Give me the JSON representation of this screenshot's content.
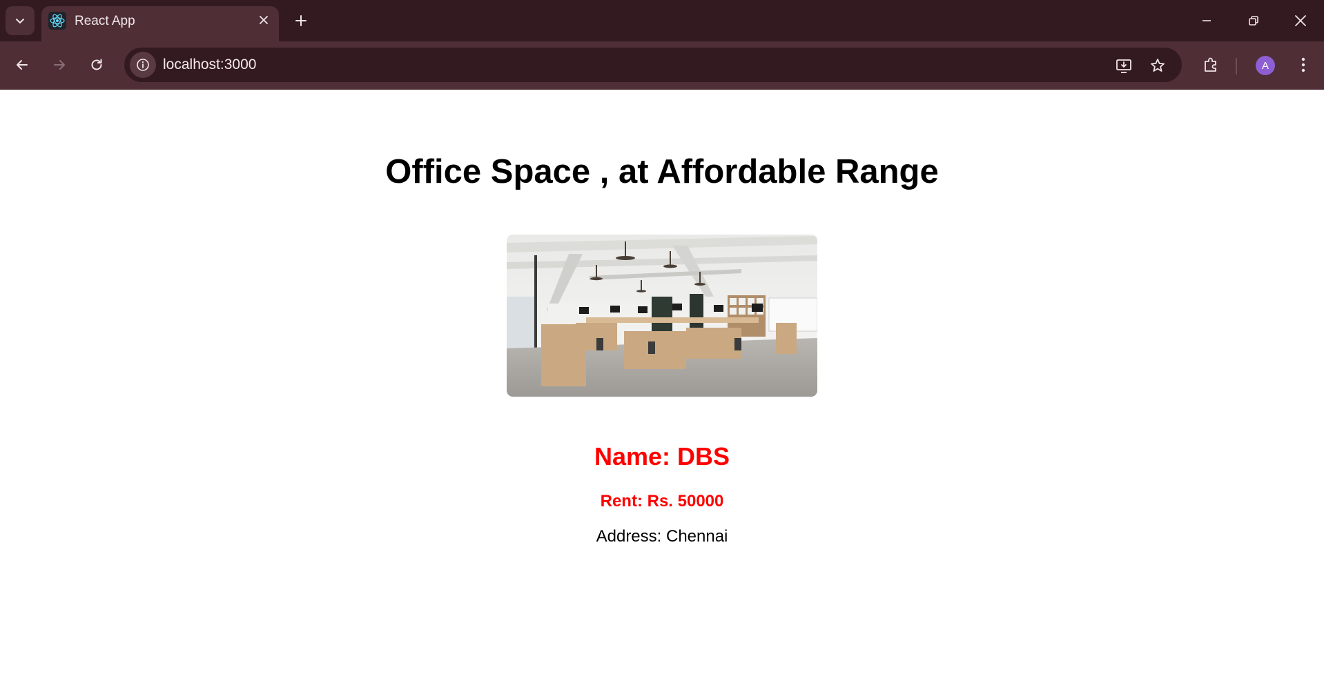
{
  "browser": {
    "tab_title": "React App",
    "url": "localhost:3000",
    "profile_initial": "A",
    "colors": {
      "frame": "#331a21",
      "toolbar": "#4f2e36",
      "avatar": "#8e5fd3"
    }
  },
  "page": {
    "heading": "Office Space , at Affordable Range",
    "name_line": "Name: DBS",
    "rent_line": "Rent: Rs. 50000",
    "address_line": "Address: Chennai",
    "colors": {
      "highlight": "#ff0000",
      "text": "#000000"
    }
  }
}
